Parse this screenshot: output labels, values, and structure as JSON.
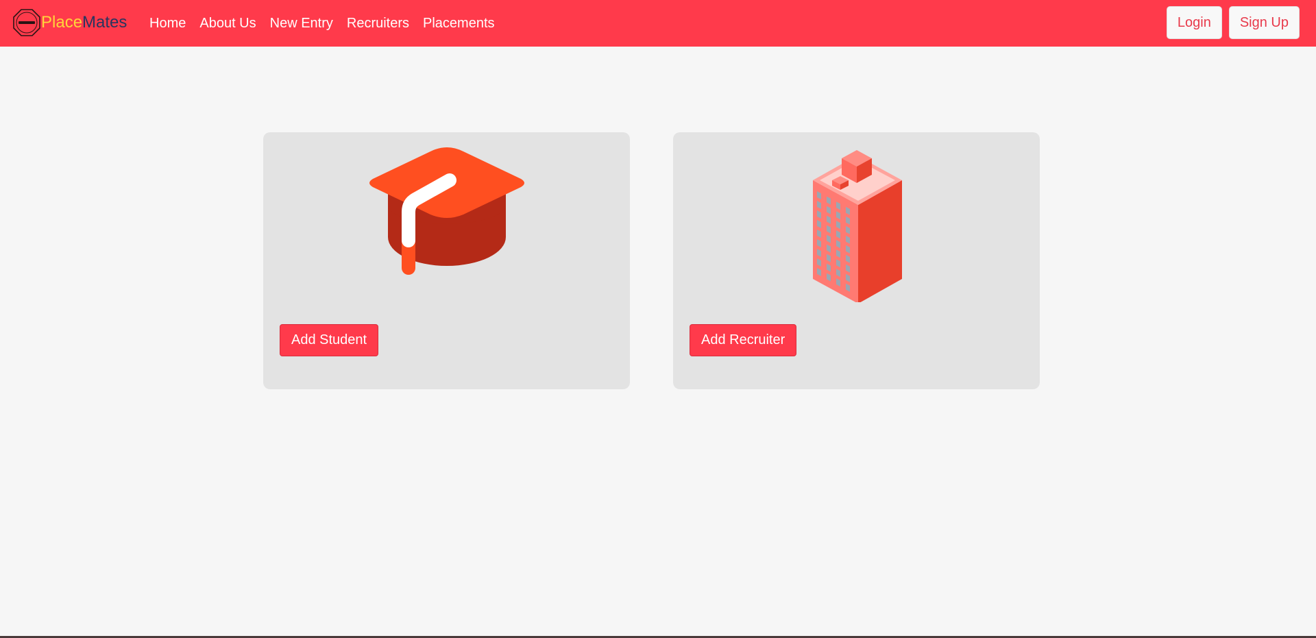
{
  "navbar": {
    "brand_part1": "Place",
    "brand_part2": "Mates",
    "links": [
      "Home",
      "About Us",
      "New Entry",
      "Recruiters",
      "Placements"
    ],
    "login_label": "Login",
    "signup_label": "Sign Up",
    "background_color": "#ff3a4b"
  },
  "cards": [
    {
      "icon": "graduation-cap-icon",
      "button_label": "Add Student"
    },
    {
      "icon": "office-building-icon",
      "button_label": "Add Recruiter"
    }
  ],
  "colors": {
    "accent": "#ff3a4b",
    "page_background": "#f6f6f6",
    "card_background": "#e3e3e3",
    "brand_yellow": "#ffd53a",
    "brand_navy": "#28355f"
  }
}
